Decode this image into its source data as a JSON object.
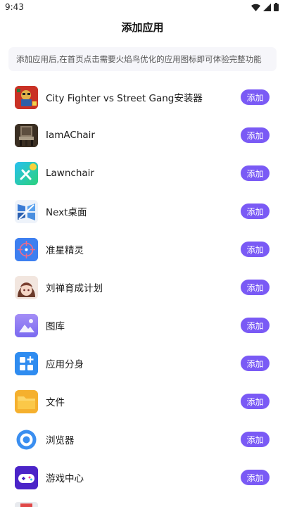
{
  "status_bar": {
    "time": "9:43"
  },
  "header": {
    "title": "添加应用"
  },
  "notice": {
    "text": "添加应用后,在首页点击需要火焰鸟优化的应用图标即可体验完整功能"
  },
  "apps": [
    {
      "name": "City Fighter vs Street Gang安装器",
      "action": "添加"
    },
    {
      "name": "IamAChair",
      "action": "添加"
    },
    {
      "name": "Lawnchair",
      "action": "添加"
    },
    {
      "name": "Next桌面",
      "action": "添加"
    },
    {
      "name": "准星精灵",
      "action": "添加"
    },
    {
      "name": "刘禅育成计划",
      "action": "添加"
    },
    {
      "name": "图库",
      "action": "添加"
    },
    {
      "name": "应用分身",
      "action": "添加"
    },
    {
      "name": "文件",
      "action": "添加"
    },
    {
      "name": "浏览器",
      "action": "添加"
    },
    {
      "name": "游戏中心",
      "action": "添加"
    }
  ],
  "colors": {
    "accent": "#7a5af5",
    "notice_bg": "#f6f6fa"
  }
}
